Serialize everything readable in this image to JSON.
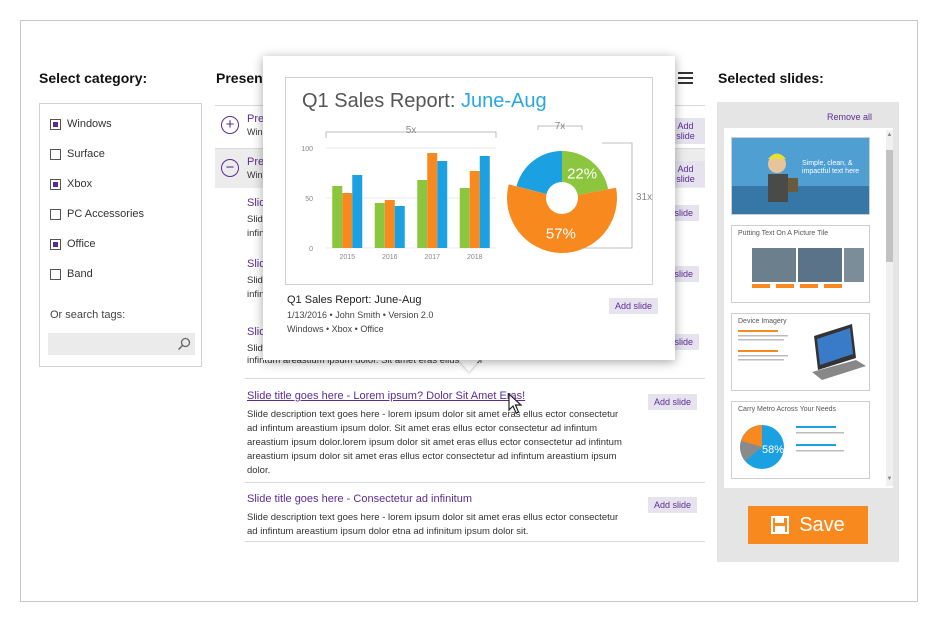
{
  "categories": {
    "title": "Select category:",
    "items": [
      {
        "label": "Windows",
        "checked": true
      },
      {
        "label": "Surface",
        "checked": false
      },
      {
        "label": "Xbox",
        "checked": true
      },
      {
        "label": "PC Accessories",
        "checked": false
      },
      {
        "label": "Office",
        "checked": true
      },
      {
        "label": "Band",
        "checked": false
      }
    ],
    "search_label": "Or search tags:",
    "search_icon": "search-icon"
  },
  "presentations": {
    "title": "Present",
    "rows": [
      {
        "title": "Pre",
        "sub": "Win",
        "icon": "plus"
      },
      {
        "title": "Pre",
        "sub": "Win",
        "icon": "minus"
      }
    ],
    "clipped_slides": [
      {
        "title": "Slid",
        "l1": "Slid",
        "l2": "infin"
      },
      {
        "title": "Slid",
        "l1": "Slid",
        "l2": "infin"
      },
      {
        "title": "Slid",
        "l1": "Slid",
        "l2": "infintum areastium ipsum dolor. Sit amet eras ellus ector"
      }
    ],
    "slides": [
      {
        "title": "Slide title goes here - Lorem ipsum? Dolor Sit Amet Eras!",
        "desc": "Slide description text goes here - lorem ipsum dolor sit amet eras ellus ector consectetur ad infintum areastium ipsum dolor. Sit amet eras ellus ector consectetur ad infintum areastium ipsum dolor.lorem ipsum dolor sit amet eras ellus ector consectetur ad infintum areastium ipsum dolor sit amet eras ellus ector consectetur ad infintum areastium ipsum dolor.",
        "add": "Add slide"
      },
      {
        "title": "Slide title goes here - Consectetur ad infinitum",
        "desc": "Slide description text goes here - lorem ipsum dolor sit amet eras ellus ector consectetur ad infintum areastium ipsum dolor etna ad infinitum ipsum dolor sit.",
        "add": "Add slide"
      }
    ],
    "add_label": "Add slide"
  },
  "popup": {
    "preview_title": "Q1 Sales Report:",
    "preview_title_accent": "June-Aug",
    "name": "Q1 Sales Report: June-Aug",
    "meta": "1/13/2016 • John Smith • Version 2.0",
    "tags": "Windows • Xbox • Office",
    "add": "Add slide"
  },
  "chart_data": [
    {
      "type": "bar",
      "categories": [
        "2015",
        "2016",
        "2017",
        "2018"
      ],
      "series": [
        {
          "values": [
            62,
            45,
            68,
            60
          ]
        },
        {
          "values": [
            55,
            48,
            95,
            77
          ]
        },
        {
          "values": [
            73,
            42,
            87,
            92
          ]
        }
      ],
      "ylim": [
        0,
        100
      ],
      "yticks": [
        "0",
        "50",
        "100"
      ],
      "annotation": "5x",
      "colors": [
        "#8cc63e",
        "#f7891f",
        "#1ba1e2"
      ]
    },
    {
      "type": "pie",
      "slices": [
        {
          "label": "22%",
          "value": 22,
          "color": "#8cc63e"
        },
        {
          "label": "57%",
          "value": 57,
          "color": "#f7891f"
        },
        {
          "label": "",
          "value": 21,
          "color": "#1ba1e2"
        }
      ],
      "annotations": [
        "7x",
        "31x"
      ]
    }
  ],
  "selected": {
    "title": "Selected slides:",
    "remove_all": "Remove all",
    "thumbs": [
      {
        "title": "Simple, clean, & impactful text here"
      },
      {
        "title": "Putting Text On A Picture Tile"
      },
      {
        "title": "Device Imagery"
      },
      {
        "title": "Carry Metro Across Your Needs",
        "pie_label": "58%"
      }
    ],
    "save": "Save"
  },
  "colors": {
    "accent": "#5c2d91",
    "orange": "#f7891f",
    "blue": "#1ba1e2",
    "green": "#8cc63e"
  }
}
